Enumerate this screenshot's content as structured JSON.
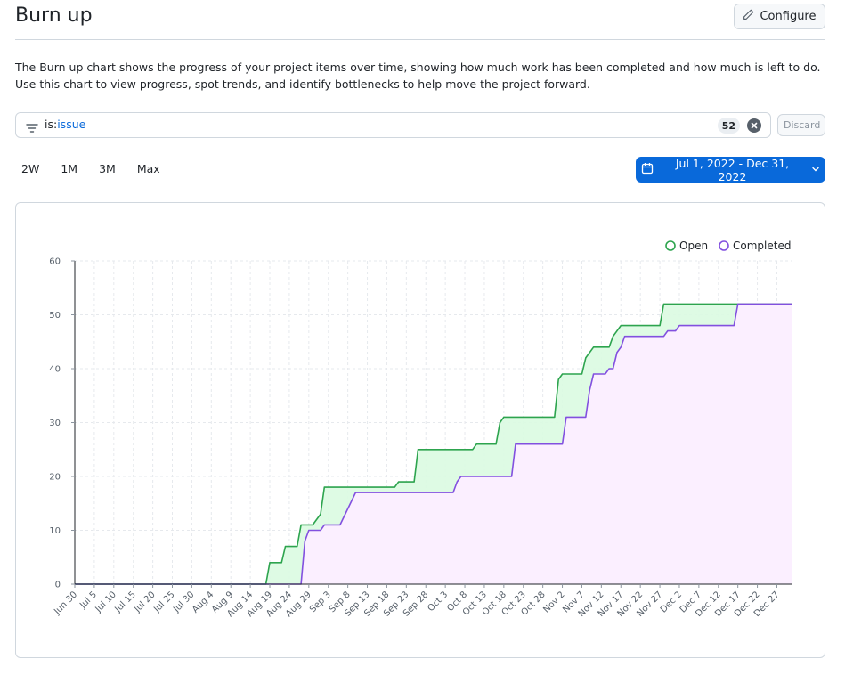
{
  "header": {
    "title": "Burn up",
    "configure_label": "Configure"
  },
  "description": "The Burn up chart shows the progress of your project items over time, showing how much work has been completed and how much is left to do. Use this chart to view progress, spot trends, and identify bottlenecks to help move the project forward.",
  "filter": {
    "key": "is:",
    "value": "issue",
    "count": "52",
    "discard_label": "Discard"
  },
  "range_tabs": [
    "2W",
    "1M",
    "3M",
    "Max"
  ],
  "date_range": "Jul 1, 2022 - Dec 31, 2022",
  "icons": {
    "configure": "pencil-icon",
    "filter": "filter-icon",
    "clear": "x-circle-icon",
    "date": "calendar-icon",
    "dropdown": "chevron-down-icon"
  },
  "colors": {
    "open": "#2da44e",
    "open_fill": "#dafbe1",
    "completed": "#8250df",
    "completed_fill": "#fbefff",
    "accent": "#0969da"
  },
  "chart_data": {
    "type": "area",
    "title": "",
    "xlabel": "",
    "ylabel": "",
    "ylim": [
      0,
      60
    ],
    "yticks": [
      0,
      10,
      20,
      30,
      40,
      50,
      60
    ],
    "xlim": [
      "2022-06-30",
      "2022-12-31"
    ],
    "xticks": [
      "Jun 30",
      "Jul 5",
      "Jul 10",
      "Jul 15",
      "Jul 20",
      "Jul 25",
      "Jul 30",
      "Aug 4",
      "Aug 9",
      "Aug 14",
      "Aug 19",
      "Aug 24",
      "Aug 29",
      "Sep 3",
      "Sep 8",
      "Sep 13",
      "Sep 18",
      "Sep 23",
      "Sep 28",
      "Oct 3",
      "Oct 8",
      "Oct 13",
      "Oct 18",
      "Oct 23",
      "Oct 28",
      "Nov 2",
      "Nov 7",
      "Nov 12",
      "Nov 17",
      "Nov 22",
      "Nov 27",
      "Dec 2",
      "Dec 7",
      "Dec 12",
      "Dec 17",
      "Dec 22",
      "Dec 27"
    ],
    "grid": true,
    "legend": "top-right",
    "series": [
      {
        "name": "Open",
        "points": [
          [
            "2022-06-30",
            0
          ],
          [
            "2022-08-18",
            0
          ],
          [
            "2022-08-19",
            4
          ],
          [
            "2022-08-22",
            4
          ],
          [
            "2022-08-23",
            7
          ],
          [
            "2022-08-26",
            7
          ],
          [
            "2022-08-27",
            11
          ],
          [
            "2022-08-30",
            11
          ],
          [
            "2022-08-31",
            12
          ],
          [
            "2022-09-01",
            13
          ],
          [
            "2022-09-02",
            18
          ],
          [
            "2022-09-20",
            18
          ],
          [
            "2022-09-21",
            19
          ],
          [
            "2022-09-25",
            19
          ],
          [
            "2022-09-26",
            25
          ],
          [
            "2022-10-10",
            25
          ],
          [
            "2022-10-11",
            26
          ],
          [
            "2022-10-16",
            26
          ],
          [
            "2022-10-17",
            30
          ],
          [
            "2022-10-18",
            31
          ],
          [
            "2022-10-31",
            31
          ],
          [
            "2022-11-01",
            38
          ],
          [
            "2022-11-02",
            39
          ],
          [
            "2022-11-07",
            39
          ],
          [
            "2022-11-08",
            42
          ],
          [
            "2022-11-10",
            44
          ],
          [
            "2022-11-14",
            44
          ],
          [
            "2022-11-15",
            46
          ],
          [
            "2022-11-17",
            48
          ],
          [
            "2022-11-27",
            48
          ],
          [
            "2022-11-28",
            52
          ],
          [
            "2022-12-31",
            52
          ]
        ]
      },
      {
        "name": "Completed",
        "points": [
          [
            "2022-06-30",
            0
          ],
          [
            "2022-08-27",
            0
          ],
          [
            "2022-08-28",
            8
          ],
          [
            "2022-08-29",
            10
          ],
          [
            "2022-09-01",
            10
          ],
          [
            "2022-09-02",
            11
          ],
          [
            "2022-09-06",
            11
          ],
          [
            "2022-09-10",
            17
          ],
          [
            "2022-10-05",
            17
          ],
          [
            "2022-10-06",
            19
          ],
          [
            "2022-10-07",
            20
          ],
          [
            "2022-10-20",
            20
          ],
          [
            "2022-10-21",
            26
          ],
          [
            "2022-11-02",
            26
          ],
          [
            "2022-11-03",
            31
          ],
          [
            "2022-11-08",
            31
          ],
          [
            "2022-11-09",
            36
          ],
          [
            "2022-11-10",
            39
          ],
          [
            "2022-11-13",
            39
          ],
          [
            "2022-11-14",
            40
          ],
          [
            "2022-11-15",
            40
          ],
          [
            "2022-11-16",
            43
          ],
          [
            "2022-11-17",
            44
          ],
          [
            "2022-11-18",
            46
          ],
          [
            "2022-11-28",
            46
          ],
          [
            "2022-11-29",
            47
          ],
          [
            "2022-12-01",
            47
          ],
          [
            "2022-12-02",
            48
          ],
          [
            "2022-12-16",
            48
          ],
          [
            "2022-12-17",
            52
          ],
          [
            "2022-12-31",
            52
          ]
        ]
      }
    ]
  }
}
